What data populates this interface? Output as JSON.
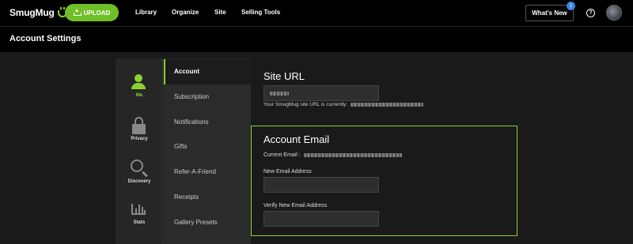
{
  "topbar": {
    "logo": "SmugMug",
    "upload_label": "UPLOAD",
    "nav": [
      "Library",
      "Organize",
      "Site",
      "Selling Tools"
    ],
    "whats_new_label": "What's New",
    "whats_new_count": "1",
    "help_symbol": "?"
  },
  "header": {
    "title": "Account Settings"
  },
  "sidebar_icons": [
    {
      "label": "Me",
      "icon": "person-icon"
    },
    {
      "label": "Privacy",
      "icon": "lock-icon"
    },
    {
      "label": "Discovery",
      "icon": "magnifier-icon"
    },
    {
      "label": "Stats",
      "icon": "stats-icon"
    }
  ],
  "menu": [
    {
      "label": "Account",
      "active": true
    },
    {
      "label": "Subscription"
    },
    {
      "label": "Notifications"
    },
    {
      "label": "Gifts"
    },
    {
      "label": "Refer-A-Friend"
    },
    {
      "label": "Receipts"
    },
    {
      "label": "Gallery Presets"
    }
  ],
  "site_url": {
    "title": "Site URL",
    "helper": "Your SmugMug site URL is currently:"
  },
  "account_email": {
    "title": "Account Email",
    "current_label": "Current Email :",
    "new_label": "New Email Address",
    "verify_label": "Verify New Email Address"
  },
  "colors": {
    "accent": "#8bd22d",
    "upload": "#6fbf28",
    "badge": "#3a86e0"
  }
}
